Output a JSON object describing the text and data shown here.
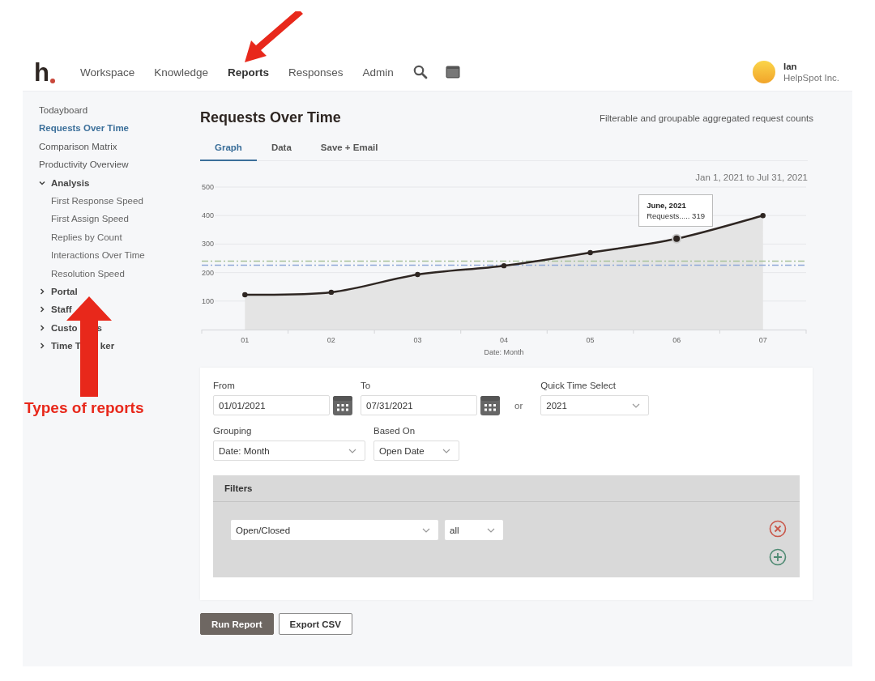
{
  "nav": {
    "logo": "h",
    "items": [
      {
        "label": "Workspace",
        "selected": false
      },
      {
        "label": "Knowledge",
        "selected": false
      },
      {
        "label": "Reports",
        "selected": true
      },
      {
        "label": "Responses",
        "selected": false
      },
      {
        "label": "Admin",
        "selected": false
      }
    ],
    "user": {
      "name": "Ian",
      "company": "HelpSpot Inc."
    }
  },
  "sidebar": {
    "items": [
      {
        "label": "Todayboard",
        "selected": false
      },
      {
        "label": "Requests Over Time",
        "selected": true
      },
      {
        "label": "Comparison Matrix",
        "selected": false
      },
      {
        "label": "Productivity Overview",
        "selected": false
      },
      {
        "label": "Analysis",
        "expanded": true,
        "children": [
          {
            "label": "First Response Speed",
            "selected": false
          },
          {
            "label": "First Assign Speed",
            "selected": false
          },
          {
            "label": "Replies by Count",
            "selected": false
          },
          {
            "label": "Interactions Over Time",
            "selected": false
          },
          {
            "label": "Resolution Speed",
            "selected": false
          }
        ]
      },
      {
        "label": "Portal",
        "expanded": false
      },
      {
        "label": "Staff",
        "expanded": false
      },
      {
        "label": "Custo",
        "label_tail": "s",
        "expanded": false
      },
      {
        "label": "Time T",
        "label_tail": "ker",
        "expanded": false
      }
    ]
  },
  "report": {
    "title": "Requests Over Time",
    "subtitle": "Filterable and groupable aggregated request counts",
    "tabs": [
      {
        "label": "Graph",
        "selected": true
      },
      {
        "label": "Data",
        "selected": false
      },
      {
        "label": "Save + Email",
        "selected": false
      }
    ],
    "date_range": "Jan 1, 2021 to Jul 31, 2021",
    "chart_data": {
      "type": "area",
      "xlabel": "Date: Month",
      "categories": [
        "01",
        "02",
        "03",
        "04",
        "05",
        "06",
        "07"
      ],
      "series": [
        {
          "name": "Requests",
          "color": "#2e2622",
          "values": [
            122,
            131,
            193,
            224,
            270,
            319,
            400
          ]
        }
      ],
      "ylim": [
        0,
        500
      ],
      "yticks": [
        100,
        200,
        300,
        400,
        500
      ],
      "grid": true,
      "ref_lines": [
        {
          "axis": "y",
          "value": 240,
          "color": "#a9c29a"
        },
        {
          "axis": "y",
          "value": 226,
          "color": "#8fa8d8"
        }
      ]
    },
    "tooltip": {
      "title": "June, 2021",
      "leader": ".....",
      "value": "319"
    }
  },
  "form": {
    "from": {
      "label": "From",
      "value": "01/01/2021"
    },
    "to": {
      "label": "To",
      "value": "07/31/2021"
    },
    "or": "or",
    "quick_time": {
      "label": "Quick Time Select",
      "value": "2021"
    },
    "grouping": {
      "label": "Grouping",
      "value": "Date: Month"
    },
    "based_on": {
      "label": "Based On",
      "value": "Open Date"
    },
    "filters": {
      "title": "Filters",
      "rows": [
        {
          "field": "Open/Closed",
          "value": "all"
        }
      ]
    }
  },
  "buttons": [
    {
      "label": "Run Report",
      "kind": "primary"
    },
    {
      "label": "Export CSV",
      "kind": "secondary"
    }
  ],
  "annotation": {
    "label": "Types of reports"
  }
}
